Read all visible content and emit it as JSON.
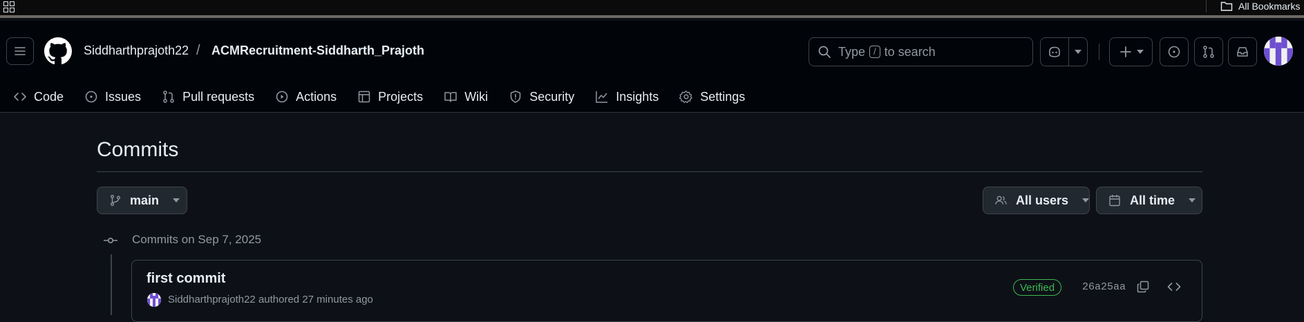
{
  "browser": {
    "bookmarks_label": "All Bookmarks"
  },
  "header": {
    "owner": "Siddharthprajoth22",
    "separator": "/",
    "repo": "ACMRecruitment-Siddharth_Prajoth",
    "search": {
      "prefix": "Type",
      "shortcut": "/",
      "suffix": "to search"
    }
  },
  "tabs": [
    {
      "label": "Code",
      "icon": "code-icon"
    },
    {
      "label": "Issues",
      "icon": "issue-icon"
    },
    {
      "label": "Pull requests",
      "icon": "pull-request-icon"
    },
    {
      "label": "Actions",
      "icon": "play-icon"
    },
    {
      "label": "Projects",
      "icon": "table-icon"
    },
    {
      "label": "Wiki",
      "icon": "book-icon"
    },
    {
      "label": "Security",
      "icon": "shield-icon"
    },
    {
      "label": "Insights",
      "icon": "graph-icon"
    },
    {
      "label": "Settings",
      "icon": "gear-icon"
    }
  ],
  "main": {
    "title": "Commits",
    "branch": "main",
    "users_filter": "All users",
    "time_filter": "All time",
    "commit_group_label": "Commits on Sep 7, 2025",
    "commits": [
      {
        "title": "first commit",
        "author": "Siddharthprajoth22",
        "action": "authored",
        "time": "27 minutes ago",
        "badge": "Verified",
        "sha": "26a25aa"
      }
    ]
  },
  "colors": {
    "bg": "#0d1117",
    "header_bg": "#010409",
    "border": "#3d444d",
    "muted": "#9198a1",
    "verified": "#3fb950",
    "avatar_accent": "#6e4fd1"
  }
}
